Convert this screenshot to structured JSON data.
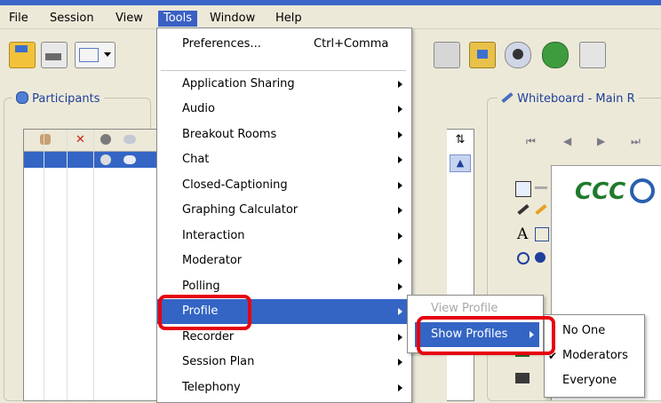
{
  "menubar": {
    "items": [
      "File",
      "Session",
      "View",
      "Tools",
      "Window",
      "Help"
    ]
  },
  "tools_menu": {
    "preferences": {
      "label": "Preferences...",
      "shortcut": "Ctrl+Comma"
    },
    "items": [
      "Application Sharing",
      "Audio",
      "Breakout Rooms",
      "Chat",
      "Closed-Captioning",
      "Graphing Calculator",
      "Interaction",
      "Moderator",
      "Polling",
      "Profile",
      "Recorder",
      "Session Plan",
      "Telephony"
    ],
    "selected": "Profile"
  },
  "profile_submenu": {
    "items": [
      "View Profile",
      "Show Profiles"
    ],
    "selected": "Show Profiles"
  },
  "show_profiles_submenu": {
    "items": [
      "No One",
      "Moderators",
      "Everyone"
    ],
    "checked": "Moderators"
  },
  "participants": {
    "title": "Participants"
  },
  "whiteboard": {
    "title": "Whiteboard - Main R",
    "logo_text": "CCC"
  },
  "colors": {
    "selection_blue": "#3465c4",
    "highlight_red": "#e6000f",
    "menubar_bg": "#ece9d8"
  }
}
